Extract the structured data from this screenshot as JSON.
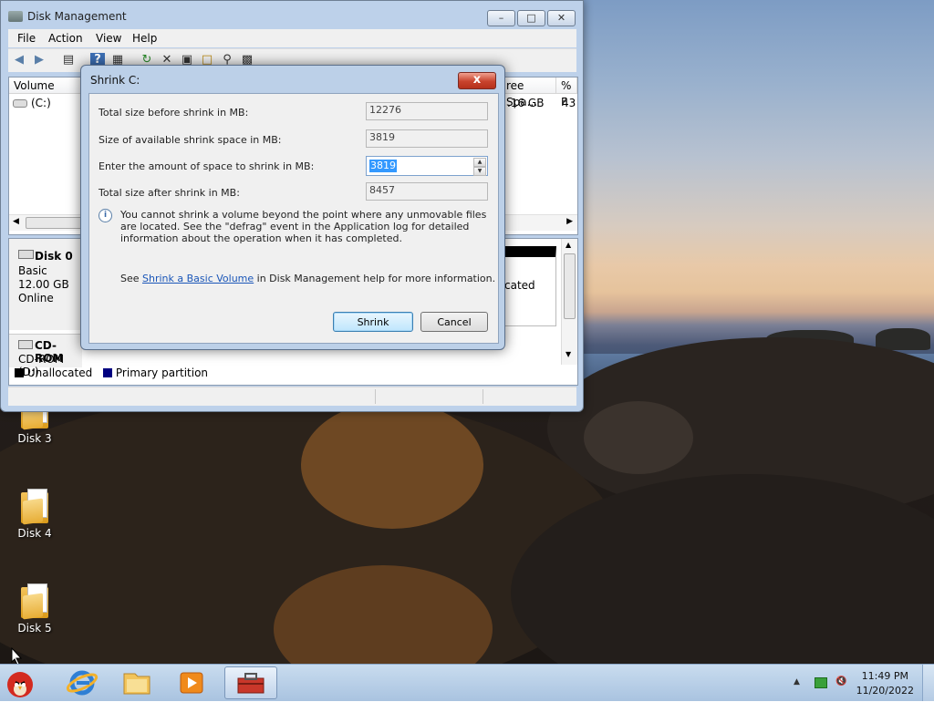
{
  "desktop": {
    "icons": [
      {
        "label": "Disk 3"
      },
      {
        "label": "Disk 4"
      },
      {
        "label": "Disk 5"
      }
    ]
  },
  "disk_mgmt": {
    "title": "Disk Management",
    "menu": [
      "File",
      "Action",
      "View",
      "Help"
    ],
    "columns": [
      "Volume",
      "ree Spa...",
      "% F"
    ],
    "volume_row": {
      "name": "(C:)",
      "free": ".16 GB",
      "pct": "43"
    },
    "disk0": {
      "name": "Disk 0",
      "type": "Basic",
      "size": "12.00 GB",
      "status": "Online",
      "partition_text": "cated"
    },
    "cdrom": {
      "name": "CD-ROM",
      "drive": "CD-ROM (D:)"
    },
    "legend": [
      {
        "label": "Unallocated",
        "color": "#000000"
      },
      {
        "label": "Primary partition",
        "color": "#000080"
      }
    ]
  },
  "dialog": {
    "title": "Shrink C:",
    "fields": {
      "total_before_label": "Total size before shrink in MB:",
      "total_before_value": "12276",
      "available_label": "Size of available shrink space in MB:",
      "available_value": "3819",
      "enter_label": "Enter the amount of space to shrink in MB:",
      "enter_value": "3819",
      "after_label": "Total size after shrink in MB:",
      "after_value": "8457"
    },
    "info_text": "You cannot shrink a volume beyond the point where any unmovable files are located. See the \"defrag\" event in the Application log for detailed information about the operation when it has completed.",
    "help_prefix": "See ",
    "help_link": "Shrink a Basic Volume",
    "help_suffix": " in Disk Management help for more information.",
    "shrink_label": "Shrink",
    "cancel_label": "Cancel",
    "close_label": "x"
  },
  "taskbar": {
    "time": "11:49 PM",
    "date": "11/20/2022"
  },
  "colors": {
    "accent": "#3399ff",
    "window_frame": "#bcd0e8"
  }
}
